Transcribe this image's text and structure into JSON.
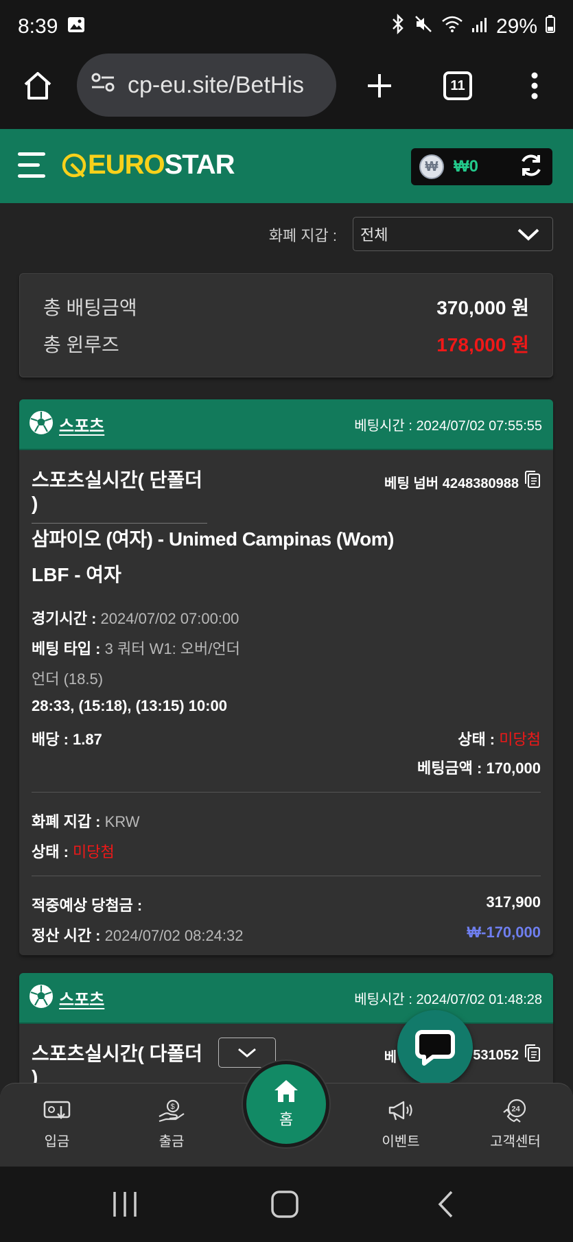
{
  "status_bar": {
    "time": "8:39",
    "battery": "29%"
  },
  "browser": {
    "url": "cp-eu.site/BetHis",
    "tab_count": "11"
  },
  "header": {
    "logo_euro": "EURO",
    "logo_star": "STAR",
    "wallet_coin": "₩",
    "wallet_balance": "₩0"
  },
  "filter": {
    "label": "화폐 지갑 :",
    "selected": "전체"
  },
  "totals": {
    "bet_label": "총 배팅금액",
    "bet_value": "370,000 원",
    "winloss_label": "총 윈루즈",
    "winloss_value": "178,000 원"
  },
  "bets": [
    {
      "category": "스포츠",
      "bet_time": "베팅시간 : 2024/07/02 07:55:55",
      "type": "스포츠실시간( 단폴더 )",
      "bet_number": "베팅 넘버 4248380988",
      "match": "삼파이오 (여자) - Unimed Campinas (Wom)",
      "league": "LBF - 여자",
      "game_time_label": "경기시간 :",
      "game_time": "2024/07/02 07:00:00",
      "bet_type_label": "베팅 타입 :",
      "bet_type": "3 쿼터 W1: 오버/언더",
      "selection": "언더 (18.5)",
      "score": "28:33, (15:18), (13:15) 10:00",
      "odds": "배당 : 1.87",
      "status_label": "상태 :",
      "status": "미당첨",
      "amount": "베팅금액 : 170,000",
      "currency_label": "화폐 지갑 :",
      "currency": "KRW",
      "status2_label": "상태 :",
      "status2": "미당첨",
      "expected_label": "적중예상 당첨금 :",
      "expected": "317,900",
      "settle_label": "정산 시간 :",
      "settle_time": "2024/07/02 08:24:32",
      "profit": "₩-170,000"
    },
    {
      "category": "스포츠",
      "bet_time": "베팅시간 : 2024/07/02 01:48:28",
      "type": "스포츠실시간( 다폴더 )",
      "bet_number_partial": "베",
      "bet_number_tail": "7531052"
    }
  ],
  "bottom_nav": {
    "deposit": "입금",
    "withdraw": "출금",
    "home": "홈",
    "event": "이벤트",
    "support": "고객센터",
    "support_badge": "24"
  },
  "colors": {
    "brand_green": "#127a5b",
    "logo_yellow": "#f7d11b",
    "loss_red": "#f01818",
    "profit_blue": "#6f7ff0",
    "balance_green": "#23c98b"
  }
}
